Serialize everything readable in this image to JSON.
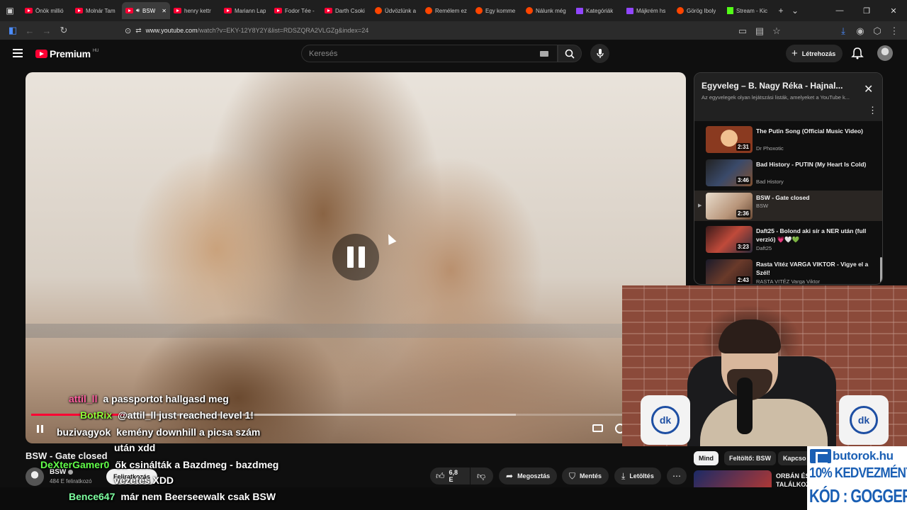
{
  "browser": {
    "tabs": [
      {
        "label": "Önök millió",
        "icon": "youtube-icon"
      },
      {
        "label": "Molnár Tam",
        "icon": "youtube-icon"
      },
      {
        "label": "BSW",
        "icon": "youtube-icon",
        "active": true
      },
      {
        "label": "henry kettr",
        "icon": "youtube-icon"
      },
      {
        "label": "Mariann Lap",
        "icon": "youtube-icon"
      },
      {
        "label": "Fodor Tée -",
        "icon": "youtube-icon"
      },
      {
        "label": "Darth Csoki",
        "icon": "youtube-icon"
      },
      {
        "label": "Üdvözlünk a",
        "icon": "reddit-icon"
      },
      {
        "label": "Remélem ez",
        "icon": "reddit-icon"
      },
      {
        "label": "Egy komme",
        "icon": "reddit-icon"
      },
      {
        "label": "Nálunk még",
        "icon": "reddit-icon"
      },
      {
        "label": "Kategóriák",
        "icon": "twitch-icon"
      },
      {
        "label": "Májkrém hs",
        "icon": "twitch-icon"
      },
      {
        "label": "Görög Iboly",
        "icon": "reddit-icon"
      },
      {
        "label": "Stream - Kic",
        "icon": "kick-icon"
      }
    ],
    "url_host": "www.youtube.com",
    "url_path": "/watch?v=EKY-12Y8Y2Y&list=RDSZQRA2VLGZg&index=24"
  },
  "header": {
    "logo_text": "Premium",
    "logo_region": "HU",
    "search_placeholder": "Keresés",
    "create_label": "Létrehozás"
  },
  "video": {
    "title": "BSW - Gate closed",
    "progress": 0.16,
    "buffered": 0.82,
    "channel": {
      "name": "BSW",
      "subs": "484 E feliratkozó",
      "subscribe_label": "Feliratkozás"
    },
    "actions": {
      "likes": "6,8 E",
      "share": "Megosztás",
      "save": "Mentés",
      "download": "Letöltés"
    }
  },
  "playlist": {
    "title": "Egyveleg – B. Nagy Réka - Hajnal...",
    "subtitle": "Az egyvelegek olyan lejátszási listák, amelyeket a YouTube k...",
    "items": [
      {
        "title": "The Putin Song (Official Music Video)",
        "channel": "Dr Phoxotic",
        "duration": "2:31"
      },
      {
        "title": "Bad History - PUTIN (My Heart Is Cold)",
        "channel": "Bad History",
        "duration": "3:46"
      },
      {
        "title": "BSW - Gate closed",
        "channel": "BSW",
        "duration": "2:36",
        "current": true
      },
      {
        "title": "Daft25 - Bolond aki sír a NER után (full verzió) 💗🤍💚",
        "channel": "Daft25",
        "duration": "3:23"
      },
      {
        "title": "Rasta Vitéz VARGA VIKTOR - Vigye el a Szél!",
        "channel": "RASTA VITÉZ Varga Viktor",
        "duration": "2:43"
      }
    ]
  },
  "chips": [
    "Mind",
    "Feltöltő: BSW",
    "Kapcso"
  ],
  "recommendation": {
    "title": "ORBÁN ÉS TALÁLKOZ"
  },
  "webcam": {
    "logo_text": "dk"
  },
  "sponsor": {
    "site": "butorok.hu",
    "offer": "10% KEDVEZMÉNY",
    "code": "KÓD : GOGGER"
  },
  "chat": [
    {
      "user": "attil_ll",
      "message": "a passportot hallgasd meg",
      "color": "#ff5fa0"
    },
    {
      "user": "BotRix",
      "message": "@attil_ll just reached level 1!",
      "color": "#8cff3a"
    },
    {
      "user": "buzivagyok",
      "message": "kemény downhill a picsa szám",
      "color": "#ffffff"
    },
    {
      "user": "",
      "message": "után xdd",
      "color": "#ffffff"
    },
    {
      "user": "DeXterGamer0",
      "message": "ők csinálták a Bazdmeg - bazdmeg",
      "color": "#62ff4a"
    },
    {
      "user": "",
      "message": "vezetés XDD",
      "color": "#ffffff"
    },
    {
      "user": "Bence647",
      "message": "már nem Beerseewalk csak BSW",
      "color": "#7dffa0"
    }
  ]
}
